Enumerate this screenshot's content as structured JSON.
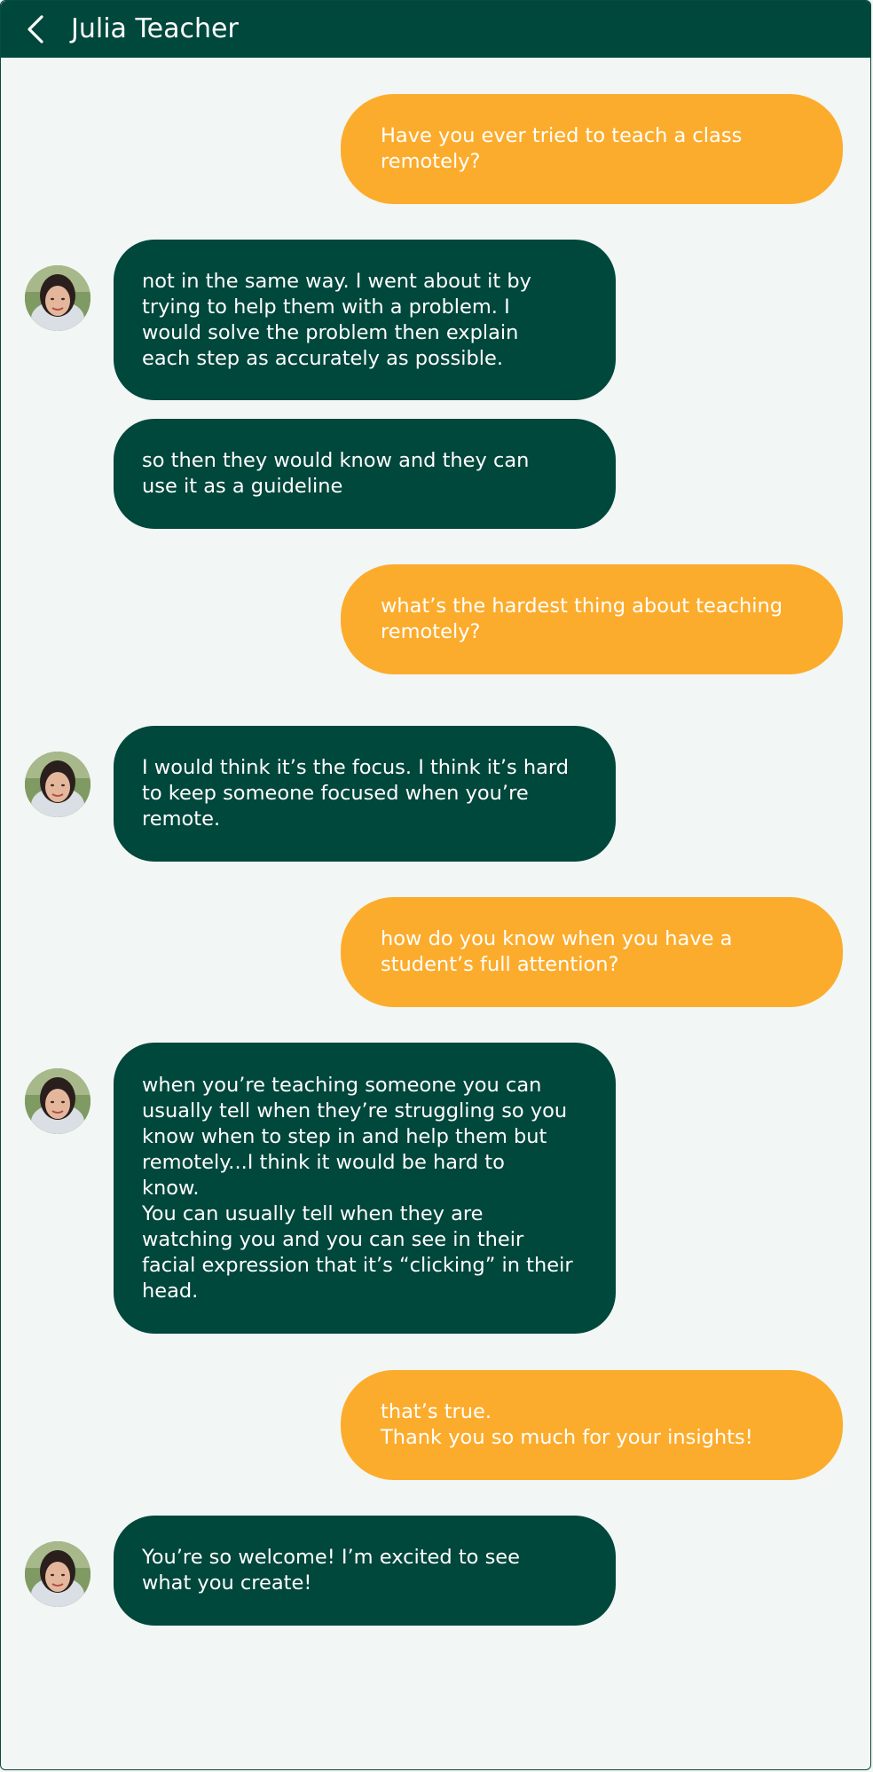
{
  "header": {
    "title": "Julia Teacher",
    "back_icon": "chevron-left-icon"
  },
  "colors": {
    "header_bg": "#00473c",
    "incoming_bubble": "#00473c",
    "outgoing_bubble": "#fcac2c",
    "background": "#f2f6f4"
  },
  "messages": [
    {
      "sender": "user",
      "text": "Have you ever tried to teach a class\nremotely?"
    },
    {
      "sender": "teacher",
      "avatar": true,
      "text": "not in the same way. I went about it by\ntrying to help them with a problem. I\nwould solve the problem then explain\neach step as accurately as possible."
    },
    {
      "sender": "teacher",
      "avatar": false,
      "text": "so then they would know and they can\nuse it as a guideline"
    },
    {
      "sender": "user",
      "text": "what’s the hardest thing about teaching\nremotely?"
    },
    {
      "sender": "teacher",
      "avatar": true,
      "text": "I would think it’s the focus. I think it’s hard\nto keep someone focused when you’re\nremote."
    },
    {
      "sender": "user",
      "text": "how do you know when you have a\nstudent’s full attention?"
    },
    {
      "sender": "teacher",
      "avatar": true,
      "text": "when you’re teaching someone you can\nusually tell when they’re struggling so you\nknow when to step in and help them but\nremotely...I think it would be hard to\nknow.\nYou can usually tell when they are\nwatching you and you can see in their\nfacial expression that it’s “clicking” in their\nhead."
    },
    {
      "sender": "user",
      "text": "that’s true.\nThank you so much for your insights!"
    },
    {
      "sender": "teacher",
      "avatar": true,
      "text": "You’re so welcome! I’m excited to see\nwhat you create!"
    }
  ]
}
